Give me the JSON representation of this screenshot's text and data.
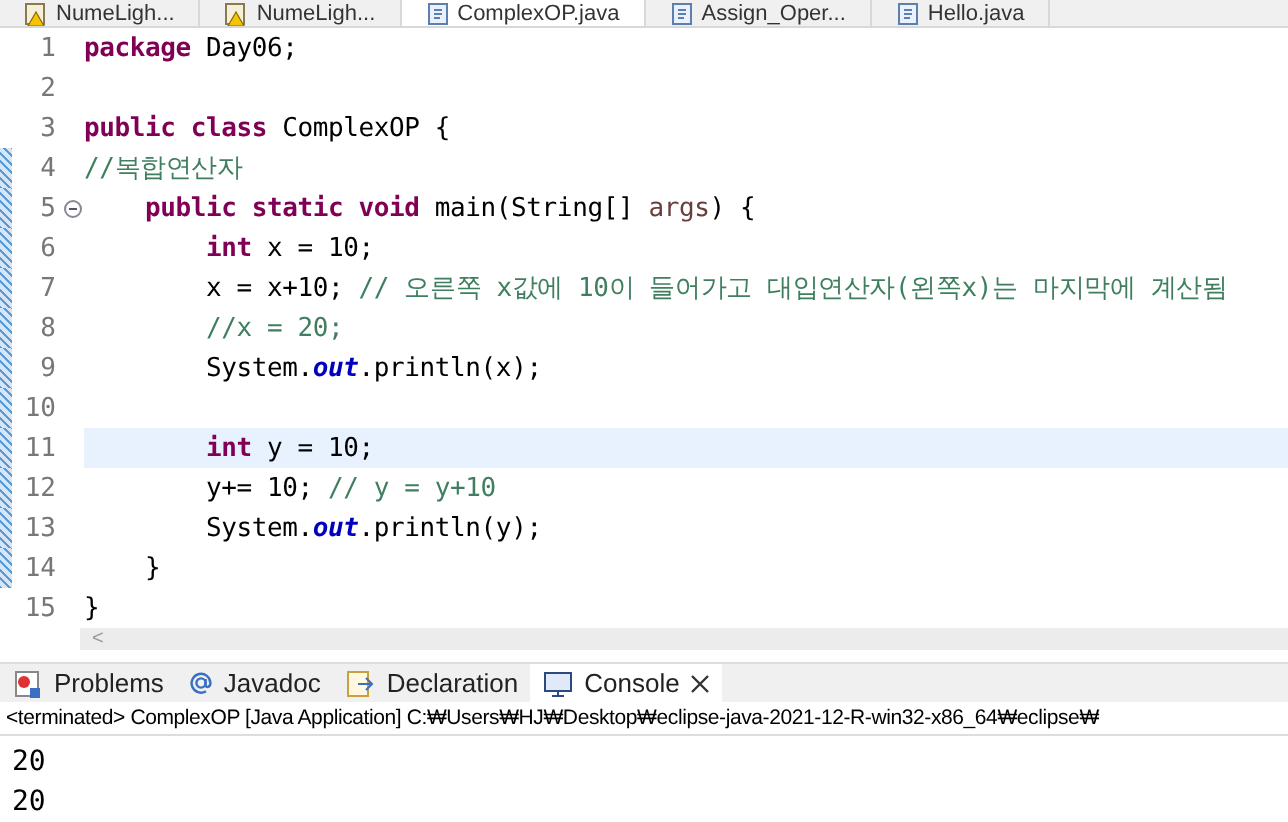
{
  "editor_tabs": [
    {
      "label": "NumeLigh...",
      "warning": true,
      "selected": false
    },
    {
      "label": "NumeLigh...",
      "warning": true,
      "selected": false
    },
    {
      "label": "ComplexOP.java",
      "warning": false,
      "selected": true
    },
    {
      "label": "Assign_Oper...",
      "warning": false,
      "selected": false
    },
    {
      "label": "Hello.java",
      "warning": false,
      "selected": false
    }
  ],
  "code_lines": [
    {
      "number": "1",
      "changed": false,
      "current": false,
      "foldable": false,
      "tokens": [
        {
          "kind": "keyword",
          "text": "package"
        },
        {
          "kind": "plain",
          "text": " Day06;"
        }
      ]
    },
    {
      "number": "2",
      "changed": false,
      "current": false,
      "foldable": false
    },
    {
      "number": "3",
      "changed": false,
      "current": false,
      "foldable": false,
      "tokens": [
        {
          "kind": "keyword",
          "text": "public class"
        },
        {
          "kind": "plain",
          "text": " ComplexOP {"
        }
      ]
    },
    {
      "number": "4",
      "changed": true,
      "current": false,
      "foldable": false,
      "tokens": [
        {
          "kind": "comment",
          "text": "//복합연산자"
        }
      ]
    },
    {
      "number": "5",
      "changed": true,
      "current": false,
      "foldable": true,
      "tokens": [
        {
          "kind": "keyword",
          "text": "    public static void"
        },
        {
          "kind": "plain",
          "text": " main(String[] "
        },
        {
          "kind": "param",
          "text": "args"
        },
        {
          "kind": "plain",
          "text": ") {"
        }
      ]
    },
    {
      "number": "6",
      "changed": true,
      "current": false,
      "foldable": false,
      "tokens": [
        {
          "kind": "keyword",
          "text": "        int"
        },
        {
          "kind": "plain",
          "text": " x = 10;"
        }
      ]
    },
    {
      "number": "7",
      "changed": true,
      "current": false,
      "foldable": false,
      "tokens": [
        {
          "kind": "plain",
          "text": "        x = x+10; "
        },
        {
          "kind": "comment",
          "text": "// 오른쪽 x값에 10이 들어가고 대입연산자(왼쪽x)는 마지막에 계산됨"
        }
      ]
    },
    {
      "number": "8",
      "changed": true,
      "current": false,
      "foldable": false,
      "tokens": [
        {
          "kind": "comment",
          "text": "        //x = 20;"
        }
      ]
    },
    {
      "number": "9",
      "changed": true,
      "current": false,
      "foldable": false,
      "tokens": [
        {
          "kind": "plain",
          "text": "        System."
        },
        {
          "kind": "field",
          "text": "out"
        },
        {
          "kind": "plain",
          "text": ".println(x);"
        }
      ]
    },
    {
      "number": "10",
      "changed": true,
      "current": false,
      "foldable": false
    },
    {
      "number": "11",
      "changed": true,
      "current": true,
      "foldable": false,
      "tokens": [
        {
          "kind": "keyword",
          "text": "        int"
        },
        {
          "kind": "plain",
          "text": " y = 10;"
        }
      ]
    },
    {
      "number": "12",
      "changed": true,
      "current": false,
      "foldable": false,
      "tokens": [
        {
          "kind": "plain",
          "text": "        y+= 10; "
        },
        {
          "kind": "comment",
          "text": "// y = y+10"
        }
      ]
    },
    {
      "number": "13",
      "changed": true,
      "current": false,
      "foldable": false,
      "tokens": [
        {
          "kind": "plain",
          "text": "        System."
        },
        {
          "kind": "field",
          "text": "out"
        },
        {
          "kind": "plain",
          "text": ".println(y);"
        }
      ]
    },
    {
      "number": "14",
      "changed": true,
      "current": false,
      "foldable": false,
      "tokens": [
        {
          "kind": "plain",
          "text": "    }"
        }
      ]
    },
    {
      "number": "15",
      "changed": false,
      "current": false,
      "foldable": false,
      "tokens": [
        {
          "kind": "plain",
          "text": "}"
        }
      ]
    }
  ],
  "scroll_left": "<",
  "view_tabs": [
    {
      "kind": "problems",
      "label": "Problems",
      "selected": false
    },
    {
      "kind": "javadoc",
      "label": "Javadoc",
      "selected": false
    },
    {
      "kind": "declaration",
      "label": "Declaration",
      "selected": false
    },
    {
      "kind": "console",
      "label": "Console",
      "selected": true
    }
  ],
  "console": {
    "status": "<terminated> ComplexOP [Java Application] C:₩Users₩HJ₩Desktop₩eclipse-java-2021-12-R-win32-x86_64₩eclipse₩",
    "output": [
      "20",
      "20"
    ]
  }
}
